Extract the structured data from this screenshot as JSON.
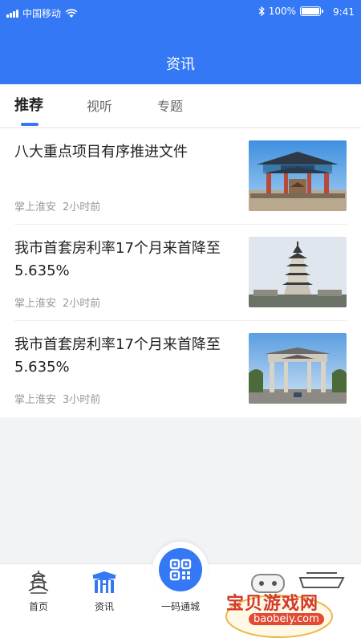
{
  "status": {
    "carrier": "中国移动",
    "battery": "100%",
    "time": "9:41"
  },
  "nav": {
    "title": "资讯"
  },
  "tabs": [
    {
      "label": "推荐",
      "active": true
    },
    {
      "label": "视听",
      "active": false
    },
    {
      "label": "专题",
      "active": false
    }
  ],
  "news": [
    {
      "title": "八大重点项目有序推进文件",
      "source": "掌上淮安",
      "time": "2小时前",
      "image": "memorial-archway"
    },
    {
      "title": "我市首套房利率17个月来首降至5.635%",
      "source": "掌上淮安",
      "time": "2小时前",
      "image": "pagoda"
    },
    {
      "title": "我市首套房利率17个月来首降至5.635%",
      "source": "掌上淮安",
      "time": "3小时前",
      "image": "street-gate"
    }
  ],
  "bottom_nav": {
    "items": [
      {
        "label": "首页",
        "icon": "pagoda-icon"
      },
      {
        "label": "资讯",
        "icon": "gate-icon",
        "active": true
      }
    ],
    "center": {
      "label": "一码通城",
      "icon": "qr-code-icon"
    }
  },
  "watermark": {
    "text": "宝贝游戏网",
    "url": "baobeiy.com"
  },
  "colors": {
    "brand": "#3478f6",
    "text": "#222222",
    "meta": "#999999"
  }
}
